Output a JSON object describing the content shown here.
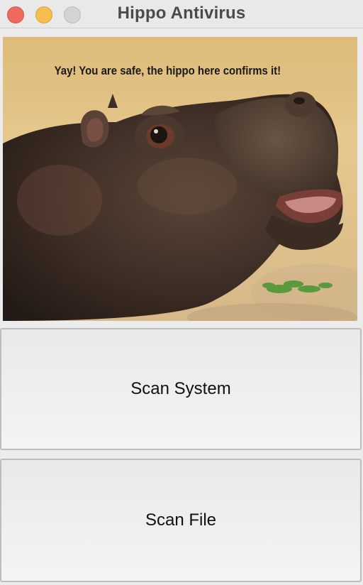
{
  "window": {
    "title": "Hippo Antivirus",
    "traffic_lights": {
      "close_color": "#ee6a5f",
      "minimize_color": "#f5be4f",
      "zoom_color": "#d3d3d3"
    }
  },
  "hero": {
    "caption": "Yay! You are safe, the hippo here confirms it!",
    "image_subject": "hippo"
  },
  "actions": {
    "scan_system_label": "Scan System",
    "scan_file_label": "Scan File"
  }
}
